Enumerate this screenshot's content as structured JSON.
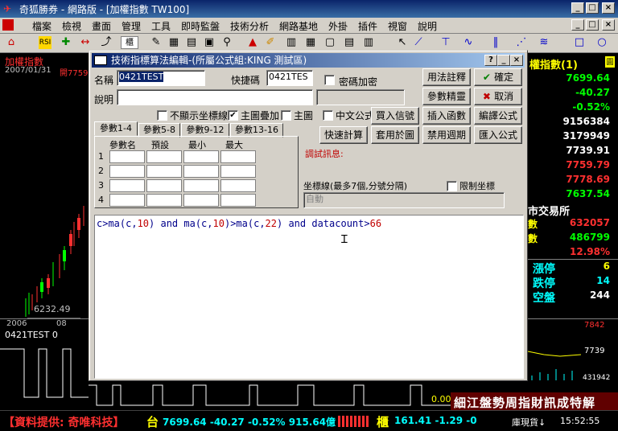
{
  "window": {
    "title": "奇狐勝券 - 網路版 - [加權指數 TW100]"
  },
  "menu": [
    "檔案",
    "檢視",
    "畫面",
    "管理",
    "工具",
    "即時監盤",
    "技術分析",
    "網路基地",
    "外掛",
    "插件",
    "視窗",
    "說明"
  ],
  "chart_left": {
    "title": "加權指數",
    "date": "2007/01/31",
    "open_label": "開7759",
    "low_price": "6232.49",
    "x_labels": [
      "2006",
      "08"
    ],
    "indicator_label": "0421TEST 0"
  },
  "right_panel": {
    "title": "權指數(1)",
    "values": [
      "7699.64",
      "-40.27",
      "-0.52%",
      "9156384",
      "3179949",
      "7739.91",
      "7759.79",
      "7778.69",
      "7637.54"
    ],
    "exchange_label": "市交易所",
    "stats": [
      {
        "label": "數",
        "value": "632057"
      },
      {
        "label": "數",
        "value": "486799"
      },
      {
        "label": "",
        "value": "12.98%"
      }
    ],
    "rise": {
      "label": "漲停",
      "value": "6"
    },
    "fall": {
      "label": "跌停",
      "value": "14"
    },
    "flat": {
      "label": "空盤",
      "value": "244"
    },
    "mini_axis": [
      "7842",
      "7739",
      "431942"
    ],
    "bottom_val": "0.00",
    "marquee": "細江盤勢周指財訊成特解"
  },
  "status": {
    "provider": "【資料提供: 奇唯科技】",
    "tai": "台",
    "tai_vals": "7699.64 -40.27 -0.52% 915.64億",
    "gui": "櫃",
    "gui_vals": "161.41 -1.29 -0",
    "cur_label": "庫現貨↓",
    "time": "15:52:55"
  },
  "dialog": {
    "title": "技術指標算法編輯-(所屬公式組:KING 測試區)",
    "name_label": "名稱",
    "name_value": "0421TEST",
    "hotkey_label": "快捷碼",
    "hotkey_value": "0421TES",
    "pwd_label": "密碼加密",
    "desc_label": "說明",
    "opt_hide_axis": "不顯示坐標線",
    "opt_overlay": "主圖疊加",
    "opt_main": "主圖",
    "opt_chinese": "中文公式",
    "tabs": [
      "參數1-4",
      "參數5-8",
      "參數9-12",
      "參數13-16"
    ],
    "param_headers": [
      "參數名",
      "預設",
      "最小",
      "最大"
    ],
    "param_rows": [
      "1",
      "2",
      "3",
      "4"
    ],
    "buttons": {
      "usage": "用法註釋",
      "ok": "確定",
      "fine": "參數精靈",
      "cancel": "取消",
      "buy": "買入信號",
      "insert": "插入函數",
      "compile": "編譯公式",
      "quick": "快速計算",
      "apply": "套用於圖",
      "disable": "禁用週期",
      "import": "匯入公式"
    },
    "debug_label": "調試訊息:",
    "axis_label": "坐標線(最多7個,分號分隔)",
    "limit_label": "限制坐標",
    "axis_placeholder": "自動",
    "code": {
      "t1": "c>ma(c,",
      "n1": "10",
      "t2": ") and ma(c,",
      "n2": "10",
      "t3": ")>ma(c,",
      "n3": "22",
      "t4": ") and datacount>",
      "n4": "66"
    }
  }
}
